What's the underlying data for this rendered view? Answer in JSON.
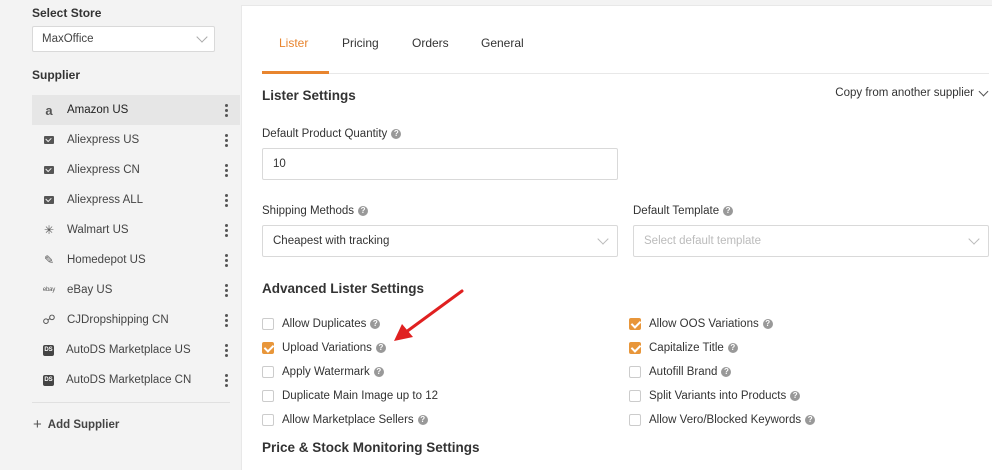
{
  "sidebar": {
    "select_store_label": "Select Store",
    "store_value": "MaxOffice",
    "supplier_label": "Supplier",
    "suppliers": [
      {
        "label": "Amazon US",
        "icon": "amazon-icon",
        "active": true
      },
      {
        "label": "Aliexpress US",
        "icon": "aliexpress-icon"
      },
      {
        "label": "Aliexpress CN",
        "icon": "aliexpress-icon"
      },
      {
        "label": "Aliexpress ALL",
        "icon": "aliexpress-icon"
      },
      {
        "label": "Walmart US",
        "icon": "walmart-icon"
      },
      {
        "label": "Homedepot US",
        "icon": "homedepot-icon"
      },
      {
        "label": "eBay US",
        "icon": "ebay-icon"
      },
      {
        "label": "CJDropshipping CN",
        "icon": "cjdropshipping-icon"
      },
      {
        "label": "AutoDS Marketplace US",
        "icon": "autods-icon"
      },
      {
        "label": "AutoDS Marketplace CN",
        "icon": "autods-icon"
      }
    ],
    "add_supplier_label": "Add Supplier"
  },
  "tabs": [
    "Lister",
    "Pricing",
    "Orders",
    "General"
  ],
  "lister_settings": {
    "title": "Lister Settings",
    "copy_label": "Copy from another supplier",
    "default_qty_label": "Default Product Quantity",
    "default_qty_value": "10",
    "shipping_label": "Shipping Methods",
    "shipping_value": "Cheapest with tracking",
    "template_label": "Default Template",
    "template_placeholder": "Select default template"
  },
  "advanced": {
    "title": "Advanced Lister Settings",
    "left": [
      {
        "label": "Allow Duplicates",
        "checked": false,
        "help": true
      },
      {
        "label": "Upload Variations",
        "checked": true,
        "help": true
      },
      {
        "label": "Apply Watermark",
        "checked": false,
        "help": true
      },
      {
        "label": "Duplicate Main Image up to 12",
        "checked": false,
        "help": false
      },
      {
        "label": "Allow Marketplace Sellers",
        "checked": false,
        "help": true
      }
    ],
    "right": [
      {
        "label": "Allow OOS Variations",
        "checked": true,
        "help": true
      },
      {
        "label": "Capitalize Title",
        "checked": true,
        "help": true
      },
      {
        "label": "Autofill Brand",
        "checked": false,
        "help": true
      },
      {
        "label": "Split Variants into Products",
        "checked": false,
        "help": true
      },
      {
        "label": "Allow Vero/Blocked Keywords",
        "checked": false,
        "help": true
      }
    ]
  },
  "monitoring": {
    "title": "Price & Stock Monitoring Settings"
  },
  "colors": {
    "accent": "#e8852f",
    "checkbox": "#e8963a",
    "arrow": "#e02020"
  }
}
